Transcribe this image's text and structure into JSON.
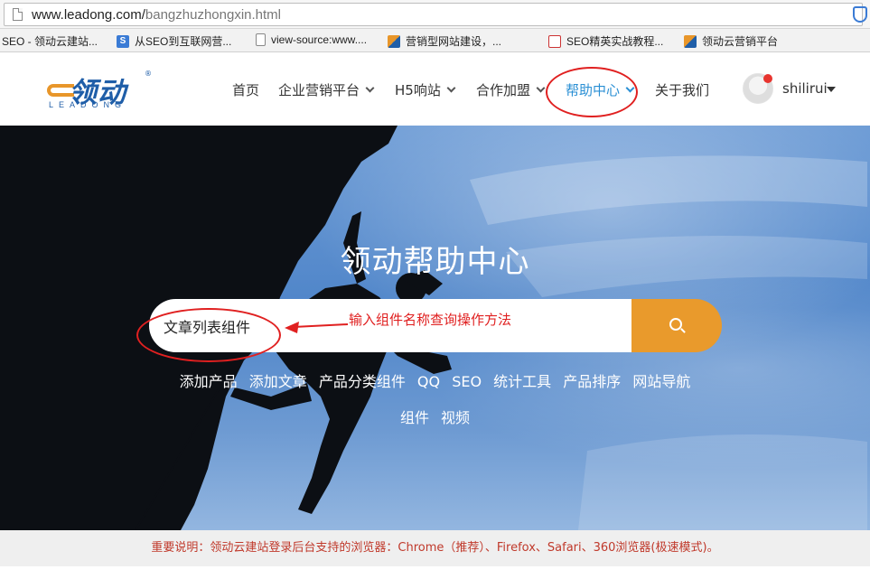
{
  "browser": {
    "url_host": "www.leadong.com/",
    "url_path": "bangzhuzhongxin.html",
    "bookmarks": [
      {
        "label": "SEO - 领动云建站...",
        "icon": "none"
      },
      {
        "label": "从SEO到互联网营...",
        "icon": "s-icon"
      },
      {
        "label": "view-source:www....",
        "icon": "page-icon"
      },
      {
        "label": "营销型网站建设，...",
        "icon": "leadong-icon"
      },
      {
        "label": "SEO精英实战教程...",
        "icon": "seo-icon"
      },
      {
        "label": "领动云营销平台",
        "icon": "leadong-icon"
      }
    ]
  },
  "header": {
    "logo_text": "领动",
    "logo_sub": "LEADONG",
    "logo_reg": "®",
    "nav": [
      {
        "label": "首页",
        "has_caret": false,
        "active": false
      },
      {
        "label": "企业营销平台",
        "has_caret": true,
        "active": false
      },
      {
        "label": "H5响站",
        "has_caret": true,
        "active": false
      },
      {
        "label": "合作加盟",
        "has_caret": true,
        "active": false
      },
      {
        "label": "帮助中心",
        "has_caret": true,
        "active": true
      },
      {
        "label": "关于我们",
        "has_caret": false,
        "active": false
      }
    ],
    "username": "shilirui"
  },
  "hero": {
    "title": "领动帮助中心",
    "search_value": "文章列表组件",
    "annotation": "输入组件名称查询操作方法",
    "tags_row1": [
      "添加产品",
      "添加文章",
      "产品分类组件",
      "QQ",
      "SEO",
      "统计工具",
      "产品排序",
      "网站导航"
    ],
    "tags_row2": [
      "组件",
      "视频"
    ]
  },
  "notice": "重要说明：领动云建站登录后台支持的浏览器：Chrome（推荐）、Firefox、Safari、360浏览器(极速模式)。",
  "colors": {
    "accent_orange": "#e99a2c",
    "nav_active": "#2a8fd4",
    "annotation_red": "#e02020",
    "notice_text": "#c0392b"
  }
}
